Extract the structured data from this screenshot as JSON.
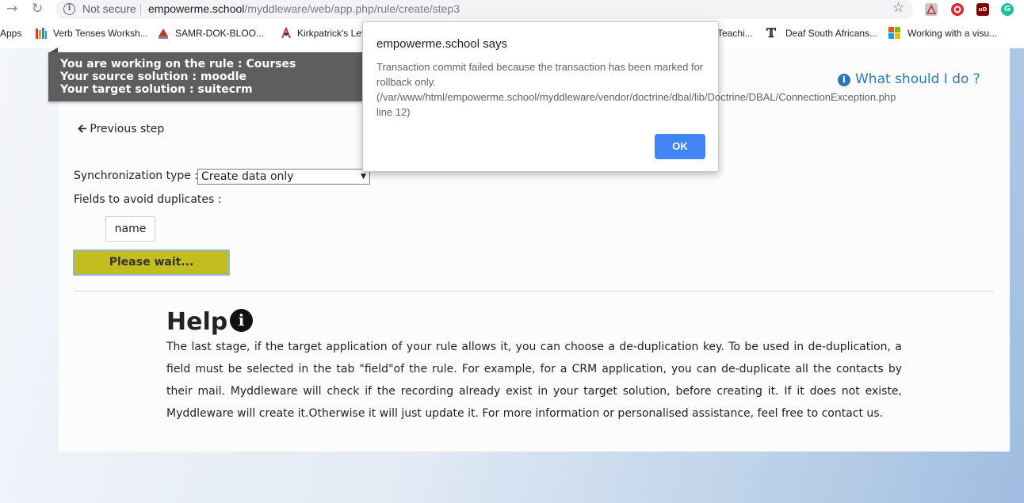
{
  "browser": {
    "security_label": "Not secure",
    "url_host": "empowerme.school",
    "url_path": "/myddleware/web/app.php/rule/create/step3",
    "bookmarks": {
      "apps": "Apps",
      "verb": "Verb Tenses Worksh...",
      "samr": "SAMR-DOK-BLOO...",
      "kirk": "Kirkpatrick's Lev",
      "teach": "Teachi...",
      "deaf": "Deaf South Africans...",
      "visual": "Working with a visu..."
    },
    "extension_letters": {
      "ublock": "uD",
      "grammarly": "G"
    }
  },
  "rule_info": {
    "rule_line": "You are working on the rule : Courses",
    "source_line": "Your source solution : moodle",
    "target_line": "Your target solution : suitecrm"
  },
  "help_link": "What should I do ?",
  "previous_step": "Previous step",
  "sync": {
    "label": "Synchronization type :",
    "selected": "Create data only"
  },
  "duplicates": {
    "label": "Fields to avoid duplicates :",
    "field": "name"
  },
  "wait_button": "Please wait...",
  "help": {
    "title": "Help",
    "text": "The last stage, if the target application of your rule allows it, you can choose a de-duplication key. To be used in de-duplication, a field must be selected in the tab \"field\"of the rule. For example, for a CRM application, you can de-duplicate all the contacts by their mail. Myddleware will check if the recording already exist in your target solution, before creating it. If it does not existe, Myddleware will create it.Otherwise it will just update it. For more information or personalised assistance, feel free to contact us."
  },
  "dialog": {
    "title": "empowerme.school says",
    "message": "Transaction commit failed because the transaction has been marked for rollback only. (/var/www/html/empowerme.school/myddleware/vendor/doctrine/dbal/lib/Doctrine/DBAL/ConnectionException.php line 12)",
    "ok": "OK"
  },
  "icons": {
    "back": "back-arrow-icon",
    "reload": "reload-icon",
    "info": "info-circle-icon",
    "bookmark_star": "star-icon",
    "previous": "arrow-left-icon",
    "help": "info-circle-icon"
  },
  "colors": {
    "banner_bg": "#5e5e5e",
    "link": "#2a7ab8",
    "wait_button": "#c4bd21",
    "dialog_ok": "#4285f4"
  }
}
